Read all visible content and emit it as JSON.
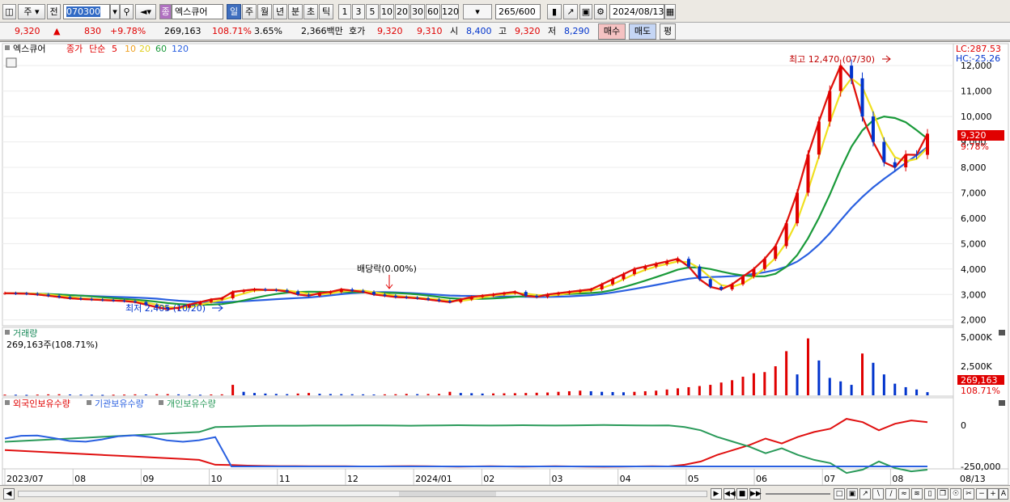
{
  "toolbar": {
    "period_type": "주",
    "prev_label": "전",
    "stock_code": "070300",
    "stock_badge": "종",
    "stock_name": "엑스큐어",
    "period_buttons": [
      "일",
      "주",
      "월",
      "년",
      "분",
      "초",
      "틱"
    ],
    "active_period": "일",
    "interval_buttons": [
      "1",
      "3",
      "5",
      "10",
      "20",
      "30",
      "60",
      "120"
    ],
    "count_current": "265",
    "count_total": "/600",
    "date": "2024/08/13"
  },
  "quote": {
    "price": "9,320",
    "change": "830",
    "change_pct": "+9.78%",
    "volume": "269,163",
    "volume_ratio": "108.71%",
    "turnover": "3.65%",
    "amount": "2,366백만",
    "bid_label": "호가",
    "ask": "9,320",
    "bid": "9,310",
    "open_label": "시",
    "open": "8,400",
    "high_label": "고",
    "high": "9,320",
    "low_label": "저",
    "low": "8,290",
    "buy_label": "매수",
    "sell_label": "매도",
    "eval_label": "평"
  },
  "colors": {
    "up": "#e00000",
    "down": "#0033cc",
    "ma5": "#e01010",
    "ma10": "#f0a020",
    "ma20": "#f0e020",
    "ma60": "#1a9a3a",
    "ma120": "#2a60e0",
    "foreign": "#e01010",
    "inst": "#2a60e0",
    "indiv": "#2a9a5a"
  },
  "chart_data": [
    {
      "type": "candlestick",
      "legend": {
        "name": "엑스큐어",
        "price_label": "종가",
        "ma_label": "단순",
        "ma_periods": [
          "5",
          "10",
          "20",
          "60",
          "120"
        ]
      },
      "lc": "LC:287.53",
      "hc": "HC:-25.26",
      "last_price_tag": "9,320",
      "last_change_tag": "9.78%",
      "yticks": [
        "12,000",
        "11,000",
        "10,000",
        "9,000",
        "8,000",
        "7,000",
        "6,000",
        "5,000",
        "4,000",
        "3,000",
        "2,000"
      ],
      "ylim": [
        1800,
        12800
      ],
      "annotation_high": "최고 12,470 (07/30)",
      "annotation_low": "최저 2,405 (10/20)",
      "annotation_dividend": "배당락(0.00%)",
      "closes": [
        3050,
        3040,
        3030,
        3000,
        2950,
        2900,
        2850,
        2820,
        2800,
        2780,
        2760,
        2740,
        2700,
        2600,
        2500,
        2420,
        2480,
        2600,
        2700,
        2800,
        2850,
        3100,
        3150,
        3200,
        3180,
        3170,
        3120,
        3000,
        2950,
        3050,
        3100,
        3200,
        3150,
        3100,
        3000,
        2950,
        2900,
        2880,
        2850,
        2800,
        2750,
        2700,
        2800,
        2900,
        2950,
        3000,
        3050,
        3100,
        2950,
        2900,
        3000,
        3050,
        3100,
        3150,
        3200,
        3400,
        3600,
        3800,
        4000,
        4100,
        4200,
        4300,
        4400,
        4100,
        3600,
        3300,
        3200,
        3400,
        3700,
        4000,
        4400,
        4900,
        5800,
        7000,
        8500,
        9800,
        11000,
        12000,
        11500,
        10000,
        9000,
        8200,
        8000,
        8500,
        8490,
        9320
      ]
    },
    {
      "type": "bar",
      "title": "거래량",
      "info": "269,163주(108.71%)",
      "yticks": [
        "5,000K",
        "2,500K"
      ],
      "last_volume_tag": "269,163",
      "last_ratio_tag": "108.71%",
      "volumes": [
        60,
        50,
        40,
        60,
        80,
        90,
        70,
        60,
        50,
        40,
        50,
        60,
        80,
        70,
        90,
        100,
        80,
        60,
        50,
        70,
        80,
        900,
        300,
        200,
        150,
        120,
        100,
        150,
        200,
        130,
        110,
        100,
        90,
        80,
        70,
        80,
        90,
        120,
        100,
        110,
        120,
        300,
        200,
        180,
        150,
        160,
        170,
        180,
        200,
        220,
        240,
        300,
        350,
        400,
        350,
        300,
        280,
        260,
        300,
        350,
        400,
        500,
        600,
        700,
        800,
        900,
        1100,
        1300,
        1600,
        1900,
        2000,
        2500,
        3800,
        1800,
        4900,
        3000,
        1500,
        1200,
        900,
        3600,
        2800,
        1800,
        1000,
        700,
        500,
        270
      ]
    },
    {
      "type": "line",
      "legend": [
        "외국인보유수량",
        "기관보유수량",
        "개인보유수량"
      ],
      "yticks": [
        "0",
        "-250,000"
      ],
      "foreign": [
        -150000,
        -155000,
        -160000,
        -165000,
        -170000,
        -175000,
        -180000,
        -185000,
        -190000,
        -195000,
        -200000,
        -205000,
        -210000,
        -240000,
        -242000,
        -245000,
        -247000,
        -248000,
        -248000,
        -249000,
        -249000,
        -249000,
        -250000,
        -250000,
        -249000,
        -248000,
        -249000,
        -250000,
        -251000,
        -250000,
        -249000,
        -250000,
        -251000,
        -250000,
        -249000,
        -250000,
        -251000,
        -252000,
        -251000,
        -250000,
        -249000,
        -250000,
        -240000,
        -220000,
        -180000,
        -150000,
        -120000,
        -80000,
        -110000,
        -70000,
        -40000,
        -20000,
        40000,
        20000,
        -30000,
        10000,
        30000,
        20000
      ]
    }
  ],
  "xaxis": {
    "labels": [
      "2023/07",
      "08",
      "09",
      "10",
      "11",
      "12",
      "2024/01",
      "02",
      "03",
      "04",
      "05",
      "06",
      "07",
      "08"
    ],
    "last_date": "08/13"
  }
}
